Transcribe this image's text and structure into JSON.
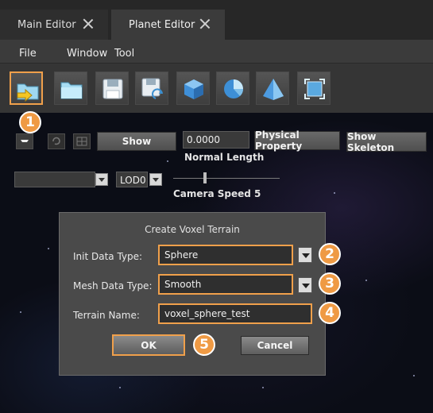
{
  "tabs": [
    {
      "label": "Main Editor",
      "active": false
    },
    {
      "label": "Planet Editor",
      "active": true
    }
  ],
  "menu": [
    "File",
    "Window",
    "Tool"
  ],
  "toolbar": {
    "icons": [
      "open-folder-arrow-icon",
      "folder-icon",
      "save-icon",
      "save-as-icon",
      "cube-icon",
      "sphere-icon",
      "pyramid-icon",
      "transform-icon"
    ]
  },
  "controls": {
    "show_label": "Show",
    "normal_length_value": "0.0000",
    "normal_length_label": "Normal Length",
    "physical_property_label": "Physical Property",
    "show_skeleton_label": "Show Skeleton",
    "lod_value": "LOD0",
    "camera_speed_label": "Camera Speed 5",
    "camera_speed_level": 0.3
  },
  "dialog": {
    "title": "Create Voxel Terrain",
    "init_data_type_label": "Init Data Type:",
    "init_data_type_value": "Sphere",
    "mesh_data_type_label": "Mesh Data Type:",
    "mesh_data_type_value": "Smooth",
    "terrain_name_label": "Terrain Name:",
    "terrain_name_value": "voxel_sphere_test",
    "ok_label": "OK",
    "cancel_label": "Cancel"
  },
  "callouts": [
    "1",
    "2",
    "3",
    "4",
    "5"
  ],
  "colors": {
    "highlight": "#f0a04b",
    "badge": "#ef9a44"
  }
}
